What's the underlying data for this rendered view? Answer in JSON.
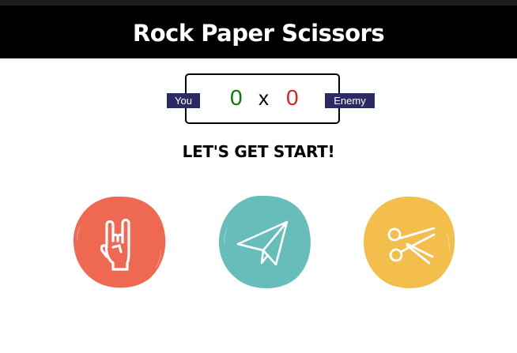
{
  "header": {
    "title": "Rock Paper Scissors"
  },
  "scoreboard": {
    "you_label": "You",
    "enemy_label": "Enemy",
    "you_score": "0",
    "separator": "x",
    "enemy_score": "0"
  },
  "status": {
    "message": "LET'S GET START!"
  },
  "choices": [
    {
      "name": "rock",
      "icon": "rock-hand-icon",
      "color": "#ef6852"
    },
    {
      "name": "paper",
      "icon": "paper-plane-icon",
      "color": "#66bdb9"
    },
    {
      "name": "scissors",
      "icon": "scissors-icon",
      "color": "#f3be4c"
    }
  ],
  "colors": {
    "header_bg": "#000000",
    "badge_bg": "#2b2a63",
    "you_score": "#0b7a0b",
    "enemy_score": "#e32020"
  }
}
